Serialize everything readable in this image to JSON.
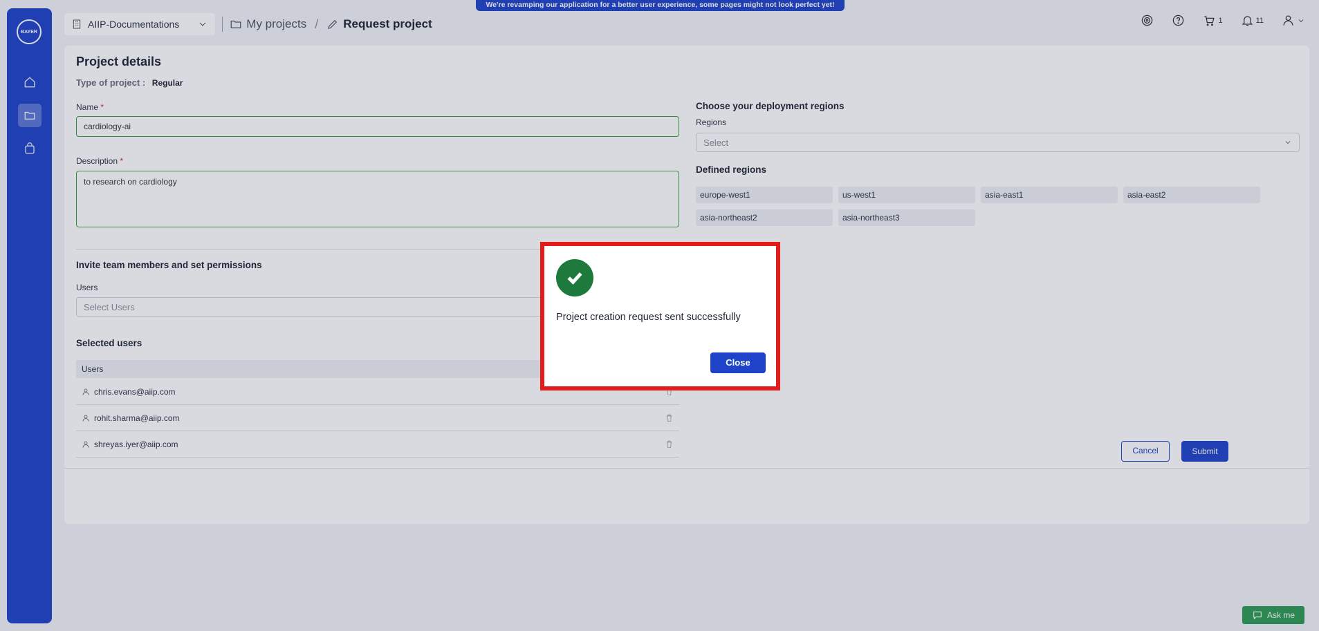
{
  "banner": "We're revamping our application for a better user experience, some pages might not look perfect yet!",
  "logo_text": "BAYER",
  "header": {
    "workspace": "AIIP-Documentations",
    "breadcrumb_1": "My projects",
    "breadcrumb_sep": "/",
    "breadcrumb_2": "Request project",
    "cart_count": "1",
    "notif_count": "11"
  },
  "form": {
    "title": "Project details",
    "type_label": "Type of project :",
    "type_value": "Regular",
    "name_label": "Name",
    "name_value": "cardiology-ai",
    "desc_label": "Description",
    "desc_value": "to research on cardiology",
    "required_mark": "*",
    "invite_title": "Invite team members and set permissions",
    "users_label": "Users",
    "users_placeholder": "Select Users",
    "selected_title": "Selected users",
    "table_header": "Users",
    "users": [
      "chris.evans@aiip.com",
      "rohit.sharma@aiip.com",
      "shreyas.iyer@aiip.com"
    ],
    "regions_title": "Choose your deployment regions",
    "regions_label": "Regions",
    "regions_placeholder": "Select",
    "defined_title": "Defined regions",
    "regions": [
      "europe-west1",
      "us-west1",
      "asia-east1",
      "asia-east2",
      "asia-northeast2",
      "asia-northeast3"
    ],
    "cancel": "Cancel",
    "submit": "Submit"
  },
  "ask_me": "Ask me",
  "dialog": {
    "message": "Project creation request sent successfully",
    "close": "Close"
  },
  "colors": {
    "brand": "#1e43c8",
    "success": "#1e7a3c",
    "highlight": "#e21b1b"
  }
}
